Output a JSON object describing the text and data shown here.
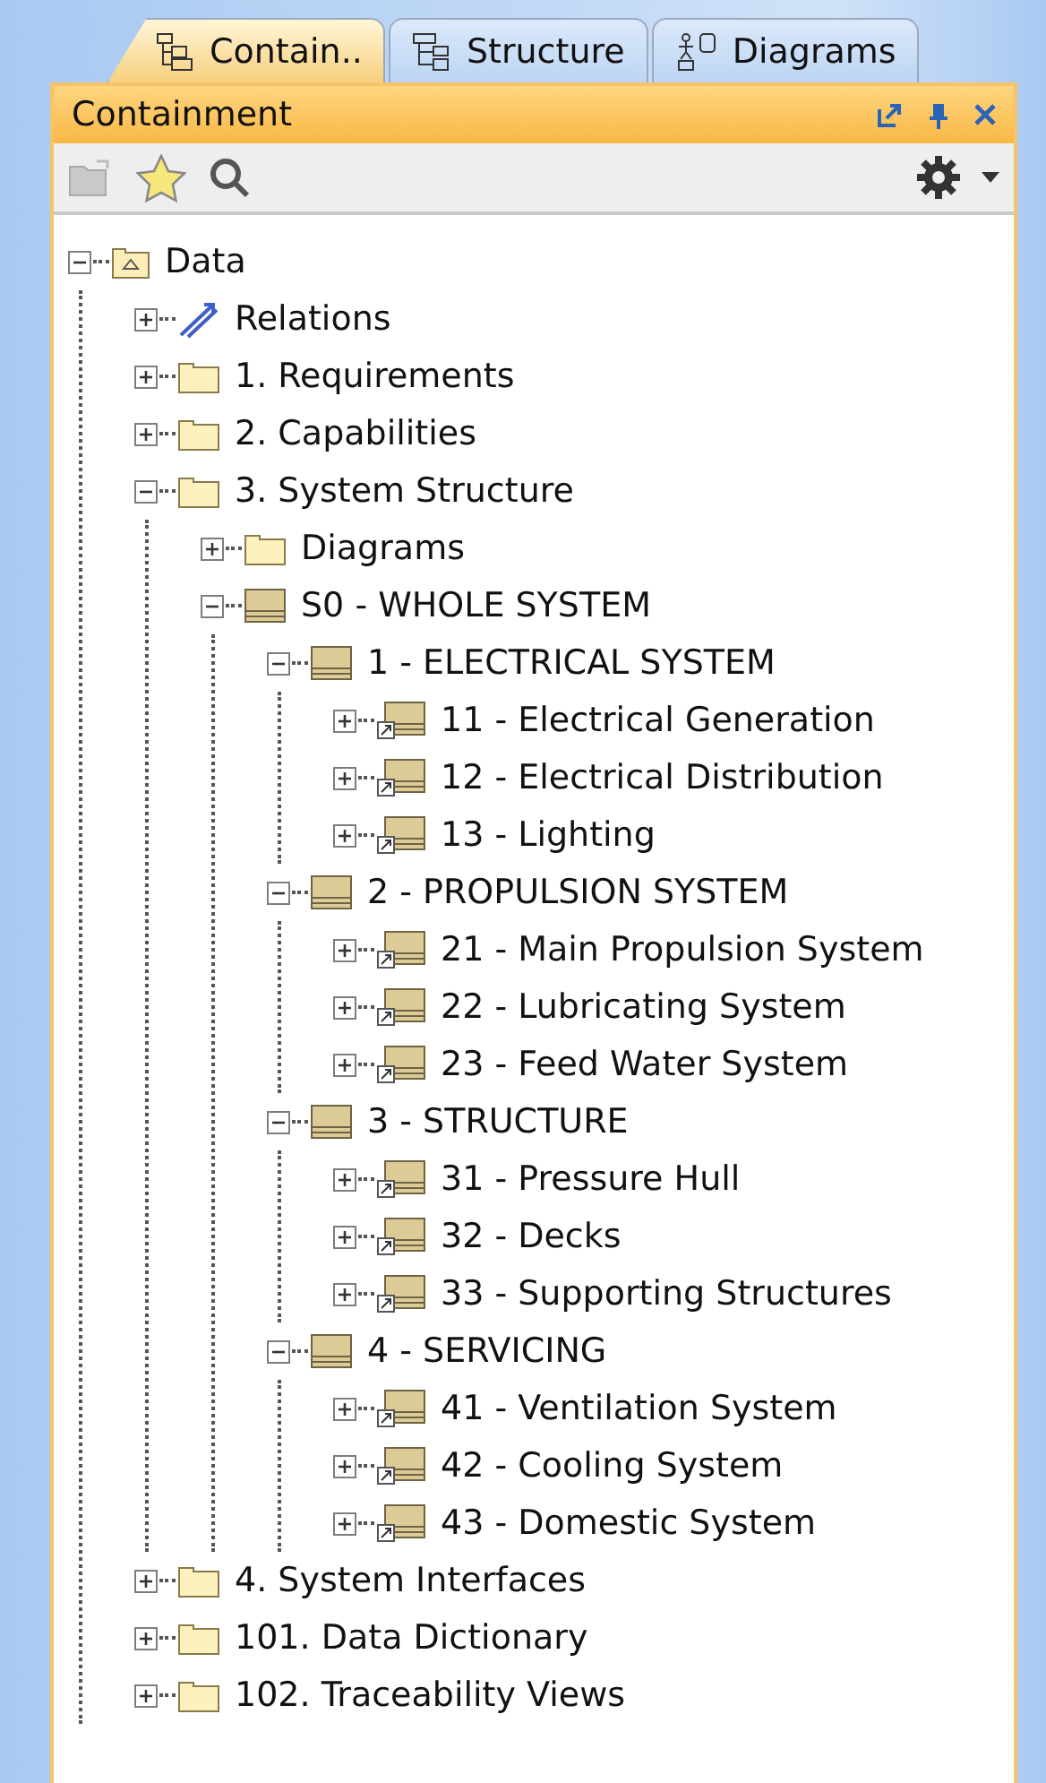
{
  "tabs": [
    {
      "label": "Contain..",
      "selected": true
    },
    {
      "label": "Structure",
      "selected": false
    },
    {
      "label": "Diagrams",
      "selected": false
    }
  ],
  "panel": {
    "title": "Containment"
  },
  "tree": [
    {
      "label": "Data",
      "kind": "model",
      "expanded": true,
      "children": [
        {
          "label": "Relations",
          "kind": "relations",
          "expanded": false
        },
        {
          "label": "1. Requirements",
          "kind": "folder",
          "expanded": false
        },
        {
          "label": "2. Capabilities",
          "kind": "folder",
          "expanded": false
        },
        {
          "label": "3. System Structure",
          "kind": "folder",
          "expanded": true,
          "children": [
            {
              "label": "Diagrams",
              "kind": "folder",
              "expanded": false
            },
            {
              "label": "S0 - WHOLE SYSTEM",
              "kind": "block",
              "expanded": true,
              "children": [
                {
                  "label": "1 - ELECTRICAL SYSTEM",
                  "kind": "block",
                  "expanded": true,
                  "children": [
                    {
                      "label": "11 - Electrical Generation",
                      "kind": "part",
                      "expanded": false
                    },
                    {
                      "label": "12 - Electrical Distribution",
                      "kind": "part",
                      "expanded": false
                    },
                    {
                      "label": "13 - Lighting",
                      "kind": "part",
                      "expanded": false
                    }
                  ]
                },
                {
                  "label": "2 - PROPULSION SYSTEM",
                  "kind": "block",
                  "expanded": true,
                  "children": [
                    {
                      "label": "21 - Main Propulsion System",
                      "kind": "part",
                      "expanded": false
                    },
                    {
                      "label": "22 - Lubricating System",
                      "kind": "part",
                      "expanded": false
                    },
                    {
                      "label": "23 - Feed Water System",
                      "kind": "part",
                      "expanded": false
                    }
                  ]
                },
                {
                  "label": "3 - STRUCTURE",
                  "kind": "block",
                  "expanded": true,
                  "children": [
                    {
                      "label": "31 - Pressure Hull",
                      "kind": "part",
                      "expanded": false
                    },
                    {
                      "label": "32 - Decks",
                      "kind": "part",
                      "expanded": false
                    },
                    {
                      "label": "33 - Supporting Structures",
                      "kind": "part",
                      "expanded": false
                    }
                  ]
                },
                {
                  "label": "4 - SERVICING",
                  "kind": "block",
                  "expanded": true,
                  "children": [
                    {
                      "label": "41 - Ventilation System",
                      "kind": "part",
                      "expanded": false
                    },
                    {
                      "label": "42 - Cooling System",
                      "kind": "part",
                      "expanded": false
                    },
                    {
                      "label": "43 - Domestic System",
                      "kind": "part",
                      "expanded": false
                    }
                  ]
                }
              ]
            }
          ]
        },
        {
          "label": "4. System Interfaces",
          "kind": "folder",
          "expanded": false
        },
        {
          "label": "101. Data Dictionary",
          "kind": "folder",
          "expanded": false
        },
        {
          "label": "102. Traceability Views",
          "kind": "folder",
          "expanded": false
        }
      ]
    }
  ]
}
